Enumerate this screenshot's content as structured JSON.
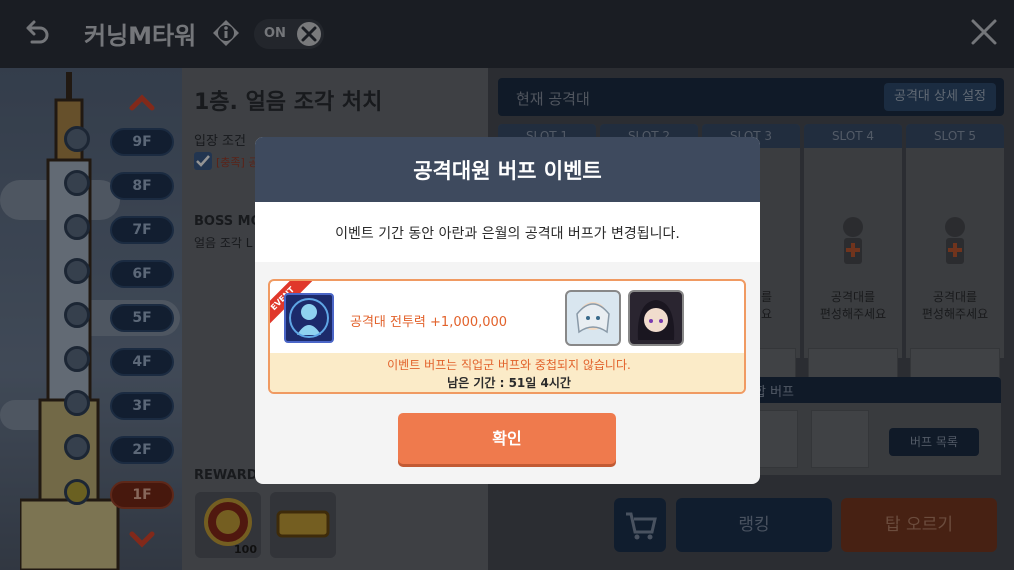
{
  "header": {
    "title": "커닝M타워",
    "toggle_label": "ON"
  },
  "tower": {
    "floors": [
      "9F",
      "8F",
      "7F",
      "6F",
      "5F",
      "4F",
      "3F",
      "2F",
      "1F"
    ],
    "current_floor": "1F"
  },
  "stage": {
    "title": "1층. 얼음 조각 처치",
    "entry_label": "입장 조건",
    "entry_text": "[충족] 공",
    "boss_label": "BOSS MO",
    "boss_text": "얼음 조각 L",
    "reward_label": "REWARD",
    "reward_count": "100"
  },
  "party": {
    "label": "현재 공격대",
    "settings_button": "공격대 상세 설정",
    "slots": [
      "SLOT 1",
      "SLOT 2",
      "SLOT 3",
      "SLOT 4",
      "SLOT 5"
    ],
    "slot_empty_text_line1": "공격대를",
    "slot_empty_text_line2": "편성해주세요",
    "slot_partial_text_line1": "대를",
    "slot_partial_text_line2": "세요",
    "combo_label": "합 버프",
    "buff_list_button": "버프 목록"
  },
  "actions": {
    "ranking": "랭킹",
    "climb": "탑 오르기"
  },
  "modal": {
    "title": "공격대원 버프 이벤트",
    "description": "이벤트 기간 동안 아란과 은월의 공격대 버프가 변경됩니다.",
    "ribbon": "EVENT",
    "buff_text": "공격대 전투력 +1,000,000",
    "notice": "이벤트 버프는 직업군 버프와 중첩되지 않습니다.",
    "remaining": "남은 기간 : 51일 4시간",
    "confirm": "확인"
  },
  "colors": {
    "modal_header": "#3e4a5e",
    "accent_orange": "#ef7a4d",
    "notice_bg": "#fbebc8"
  }
}
